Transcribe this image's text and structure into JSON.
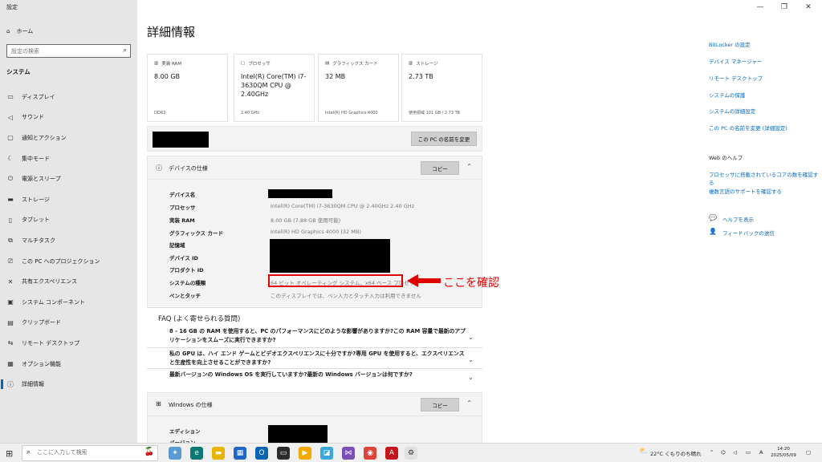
{
  "window": {
    "title": "設定",
    "minimize": "—",
    "maximize": "❐",
    "close": "✕"
  },
  "sidebar": {
    "home": "ホーム",
    "search_placeholder": "設定の検索",
    "section": "システム",
    "items": [
      {
        "label": "ディスプレイ",
        "icon": "▭"
      },
      {
        "label": "サウンド",
        "icon": "◁"
      },
      {
        "label": "通知とアクション",
        "icon": "▢"
      },
      {
        "label": "集中モード",
        "icon": "☾"
      },
      {
        "label": "電源とスリープ",
        "icon": "⏻"
      },
      {
        "label": "ストレージ",
        "icon": "▬"
      },
      {
        "label": "タブレット",
        "icon": "▯"
      },
      {
        "label": "マルチタスク",
        "icon": "⧉"
      },
      {
        "label": "この PC へのプロジェクション",
        "icon": "⎚"
      },
      {
        "label": "共有エクスペリエンス",
        "icon": "✕"
      },
      {
        "label": "システム コンポーネント",
        "icon": "▣"
      },
      {
        "label": "クリップボード",
        "icon": "▤"
      },
      {
        "label": "リモート デスクトップ",
        "icon": "⇆"
      },
      {
        "label": "オプション機能",
        "icon": "▦"
      },
      {
        "label": "詳細情報",
        "icon": "ⓘ"
      }
    ]
  },
  "main": {
    "title": "詳細情報",
    "cards": [
      {
        "label": "実装 RAM",
        "value": "8.00 GB",
        "sub": "DDR3",
        "icon": "▥"
      },
      {
        "label": "プロセッサ",
        "value": "Intel(R) Core(TM) i7-3630QM CPU @ 2.40GHz",
        "sub": "2.40 GHz",
        "icon": "▢"
      },
      {
        "label": "グラフィックス カード",
        "value": "32 MB",
        "sub": "Intel(R) HD Graphics 4000",
        "icon": "▤"
      },
      {
        "label": "ストレージ",
        "value": "2.73 TB",
        "sub": "使用領域 101 GB / 2.73 TB",
        "icon": "▥"
      }
    ],
    "rename_button": "この PC の名前を変更",
    "device_spec": {
      "title": "デバイスの仕様",
      "copy_button": "コピー",
      "rows": [
        {
          "label": "デバイス名",
          "value": ""
        },
        {
          "label": "プロセッサ",
          "value": "Intel(R) Core(TM) i7-3630QM CPU @ 2.40GHz   2.40 GHz"
        },
        {
          "label": "実装 RAM",
          "value": "8.00 GB (7.88 GB 使用可能)"
        },
        {
          "label": "グラフィックス カード",
          "value": "Intel(R) HD Graphics 4000 (32 MB)"
        },
        {
          "label": "記憶域",
          "value": ""
        },
        {
          "label": "デバイス ID",
          "value": ""
        },
        {
          "label": "プロダクト ID",
          "value": ""
        },
        {
          "label": "システムの種類",
          "value": "64 ビット オペレーティング システム、x64 ベース プロセッサ"
        },
        {
          "label": "ペンとタッチ",
          "value": "このディスプレイでは、ペン入力とタッチ入力は利用できません"
        }
      ]
    },
    "callout": "ここを確認",
    "faq": {
      "title": "FAQ (よく寄せられる質問)",
      "items": [
        "8 - 16 GB の RAM を使用すると、PC のパフォーマンスにどのような影響がありますか?この RAM 容量で最新のアプリケーションをスムーズに実行できますか?",
        "私の GPU は、ハイ エンド ゲームとビデオエクスペリエンスに十分ですか?専用 GPU を使用すると、エクスペリエンスと生産性を向上させることができますか?",
        "最新バージョンの Windows OS を実行していますか?最新の Windows バージョンは何ですか?"
      ]
    },
    "windows_spec": {
      "title": "Windows の仕様",
      "copy_button": "コピー",
      "rows": [
        "エディション",
        "バージョン"
      ]
    }
  },
  "right": {
    "links": [
      "BitLocker の設定",
      "デバイス マネージャー",
      "リモート デスクトップ",
      "システムの保護",
      "システムの詳細設定",
      "この PC の名前を変更 (詳細設定)"
    ],
    "web_help_title": "Web のヘルプ",
    "web_links": [
      "プロセッサに搭載されているコアの数を確認する",
      "複数言語のサポートを確認する"
    ],
    "help": "ヘルプを表示",
    "feedback": "フィードバックの送信"
  },
  "taskbar": {
    "search_placeholder": "ここに入力して検索",
    "weather": "22°C くもりのち晴れ",
    "ime": "A",
    "time": "14:20",
    "date": "2025/05/09"
  },
  "colors": {
    "accent": "#0067c0",
    "highlight": "#e00000",
    "sidebar_bg": "#e6e6e6",
    "panel_bg": "#f3f3f3"
  }
}
